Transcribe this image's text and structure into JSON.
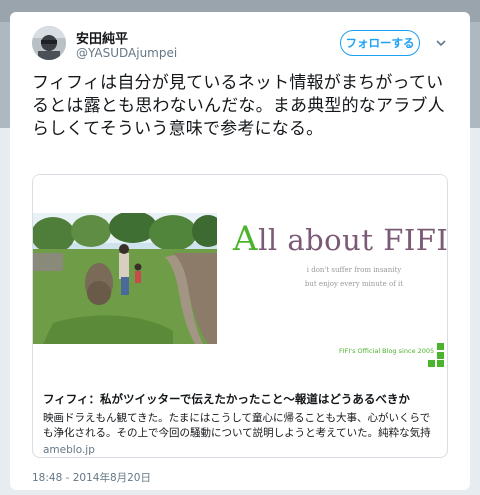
{
  "tweet": {
    "display_name": "安田純平",
    "handle": "@YASUDAjumpei",
    "follow_label": "フォローする",
    "text": "フィフィは自分が見ているネット情報がまちがっているとは露とも思わないんだな。まあ典型的なアラブ人らしくてそういう意味で参考になる。",
    "timestamp": "18:48 - 2014年8月20日"
  },
  "link_card": {
    "blog_title_initial": "A",
    "blog_title_rest": "ll about FIFI",
    "tagline_line1": "i don't suffer from insanity",
    "tagline_line2": "but enjoy every minute of it",
    "since_text": "FIFI's Official Blog since 2005",
    "title": "フィフィ：私がツイッターで伝えたかったこと～報道はどうあるべきか",
    "description": "映画ドラえもん観てきた。たまにはこうして童心に帰ることも大事、心がいくらでも浄化される。その上で今回の騒動について説明しようと考えていた。純粋な気持",
    "domain": "ameblo.jp"
  },
  "icons": {
    "avatar": "avatar-image",
    "caret": "chevron-down-icon",
    "green_squares": "blog-logo-squares-icon"
  },
  "colors": {
    "accent": "#1da1f2",
    "blog_green": "#4cb32c",
    "blog_purple": "#7a5a74"
  }
}
